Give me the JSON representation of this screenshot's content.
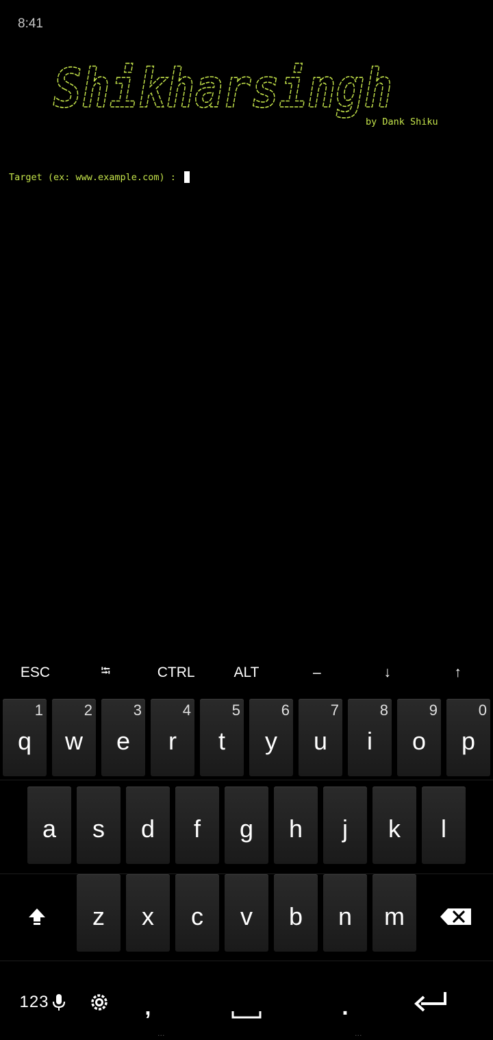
{
  "status_bar": {
    "time": "8:41"
  },
  "terminal": {
    "banner_text": "Shikharsingh",
    "byline": "by Dank Shiku",
    "prompt": "Target (ex: www.example.com) : ",
    "input_value": "",
    "text_color": "#c4e34a"
  },
  "extra_keys": [
    {
      "label": "ESC"
    },
    {
      "label": "⭾"
    },
    {
      "label": "CTRL"
    },
    {
      "label": "ALT"
    },
    {
      "label": "–"
    },
    {
      "label": "↓"
    },
    {
      "label": "↑"
    }
  ],
  "keyboard": {
    "row1": [
      {
        "key": "q",
        "hint": "1"
      },
      {
        "key": "w",
        "hint": "2"
      },
      {
        "key": "e",
        "hint": "3"
      },
      {
        "key": "r",
        "hint": "4"
      },
      {
        "key": "t",
        "hint": "5"
      },
      {
        "key": "y",
        "hint": "6"
      },
      {
        "key": "u",
        "hint": "7"
      },
      {
        "key": "i",
        "hint": "8"
      },
      {
        "key": "o",
        "hint": "9"
      },
      {
        "key": "p",
        "hint": "0"
      }
    ],
    "row2": [
      "a",
      "s",
      "d",
      "f",
      "g",
      "h",
      "j",
      "k",
      "l"
    ],
    "row3": [
      "z",
      "x",
      "c",
      "v",
      "b",
      "n",
      "m"
    ],
    "shift_icon": "shift-icon",
    "backspace_icon": "backspace-icon",
    "symbols_label": "123",
    "mic_icon": "mic-icon",
    "settings_icon": "settings-icon",
    "comma": ",",
    "period": ".",
    "space_icon": "space-icon",
    "enter_icon": "enter-icon"
  },
  "nav_dots": {
    "left": "...",
    "right": "..."
  }
}
